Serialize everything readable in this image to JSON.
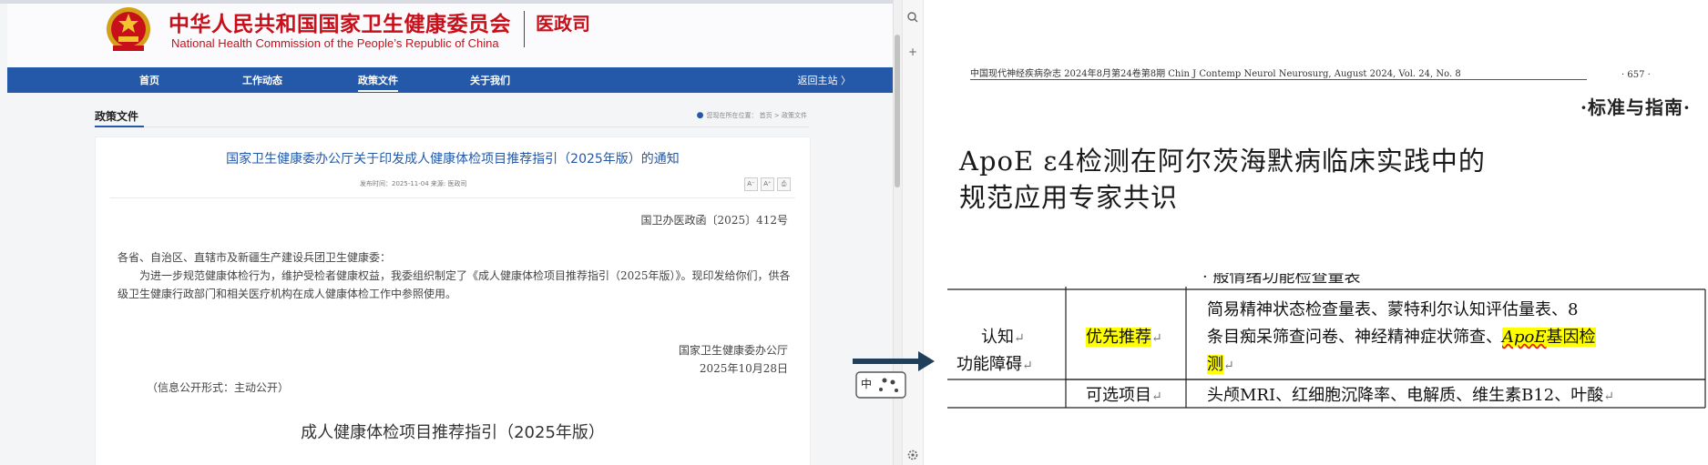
{
  "left_browser": {
    "header": {
      "site_name_cn": "中华人民共和国国家卫生健康委员会",
      "site_name_en": "National Health Commission of the People’s Republic of China",
      "department": "医政司"
    },
    "nav": {
      "items": [
        {
          "label": "首页"
        },
        {
          "label": "工作动态"
        },
        {
          "label": "政策文件",
          "active": true
        },
        {
          "label": "关于我们"
        }
      ],
      "back_label": "返回主站 〉"
    },
    "section_title": "政策文件",
    "location_text": "您现在所在位置： 首页 > 政策文件",
    "article": {
      "title": "国家卫生健康委办公厅关于印发成人健康体检项目推荐指引（2025年版）的通知",
      "meta": "发布时间：2025-11-04    来源: 医政司",
      "tools": [
        "A⁻",
        "A⁺",
        "⎙"
      ],
      "doc_number": "国卫办医政函〔2025〕412号",
      "salutation": "各省、自治区、直辖市及新疆生产建设兵团卫生健康委：",
      "paragraph": "为进一步规范健康体检行为，维护受检者健康权益，我委组织制定了《成人健康体检项目推荐指引（2025年版）》。现印发给你们，供各级卫生健康行政部门和相关医疗机构在成人健康体检工作中参照使用。",
      "signer_org": "国家卫生健康委办公厅",
      "sign_date": "2025年10月28日",
      "disclosure": "（信息公开形式：主动公开）",
      "guide_title": "成人健康体检项目推荐指引（2025年版）"
    }
  },
  "sidebar_strip": {
    "buttons": [
      "search-icon",
      "plus-icon",
      "gear-icon"
    ]
  },
  "ime_indicator": "中",
  "right_doc": {
    "journal_header": "中国现代神经疾病杂志 2024年8月第24卷第8期    Chin J Contemp Neurol Neurosurg, August 2024, Vol. 24, No. 8",
    "page_number": "· 657 ·",
    "category": "·标准与指南·",
    "title_line1": "ApoE ε4检测在阿尔茨海默病临床实践中的",
    "title_line2": "规范应用专家共识",
    "table": {
      "cut_text": "·  般情绪功能检查量表",
      "category_line1": "认知",
      "category_line2": "功能障碍",
      "recommended_label": "优先推荐",
      "recommended_line1": "简易精神状态检查量表、蒙特利尔认知评估量表、8",
      "recommended_line2_pre": "条目痴呆筛查问卷、神经精神症状筛查、",
      "recommended_line2_gene": "ApoE",
      "recommended_line2_post": "基因检",
      "recommended_line3": "测",
      "optional_label": "可选项目",
      "optional_items": "头颅MRI、红细胞沉降率、电解质、维生素B12、叶酸",
      "para_mark": "↵"
    }
  },
  "colors": {
    "gov_red": "#c8101b",
    "nav_blue": "#2458a8",
    "highlight": "#ffff00"
  }
}
